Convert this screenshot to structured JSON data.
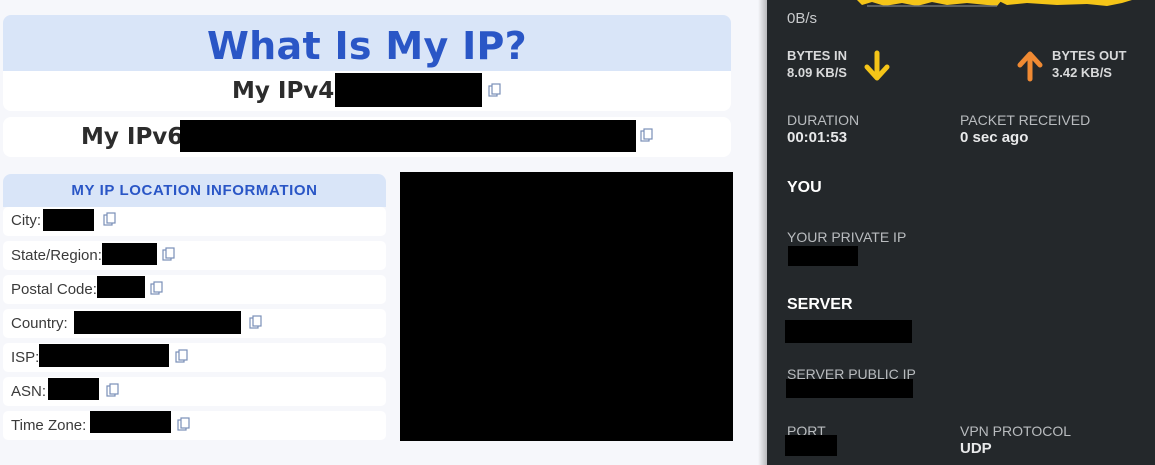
{
  "main": {
    "title": "What Is My IP?",
    "ipv4_label": "My IPv4:",
    "ipv6_label": "My IPv6:",
    "location_header": "MY IP LOCATION INFORMATION",
    "location_rows": [
      {
        "label": "City:"
      },
      {
        "label": "State/Region:"
      },
      {
        "label": "Postal Code:"
      },
      {
        "label": "Country:"
      },
      {
        "label": "ISP:"
      },
      {
        "label": "ASN:"
      },
      {
        "label": "Time Zone:"
      }
    ]
  },
  "vpn_panel": {
    "speed": "0B/s",
    "bytes_in_label": "BYTES IN",
    "bytes_in_value": "8.09 KB/S",
    "bytes_out_label": "BYTES OUT",
    "bytes_out_value": "3.42 KB/S",
    "duration_label": "DURATION",
    "duration_value": "00:01:53",
    "packet_label": "PACKET RECEIVED",
    "packet_value": "0 sec ago",
    "you_section": "YOU",
    "private_ip_label": "YOUR PRIVATE IP",
    "server_section": "SERVER",
    "server_public_ip_label": "SERVER PUBLIC IP",
    "port_label": "PORT",
    "vpn_protocol_label": "VPN PROTOCOL",
    "vpn_protocol_value": "UDP"
  },
  "colors": {
    "accent": "#2a56c6",
    "header_bg": "#d9e5f8",
    "panel_bg": "#24282b",
    "arrow_in": "#f5c518",
    "arrow_out": "#f08a33"
  },
  "icons": {
    "copy": "copy-icon",
    "arrow_in": "arrow-down-icon",
    "arrow_out": "arrow-up-icon"
  }
}
